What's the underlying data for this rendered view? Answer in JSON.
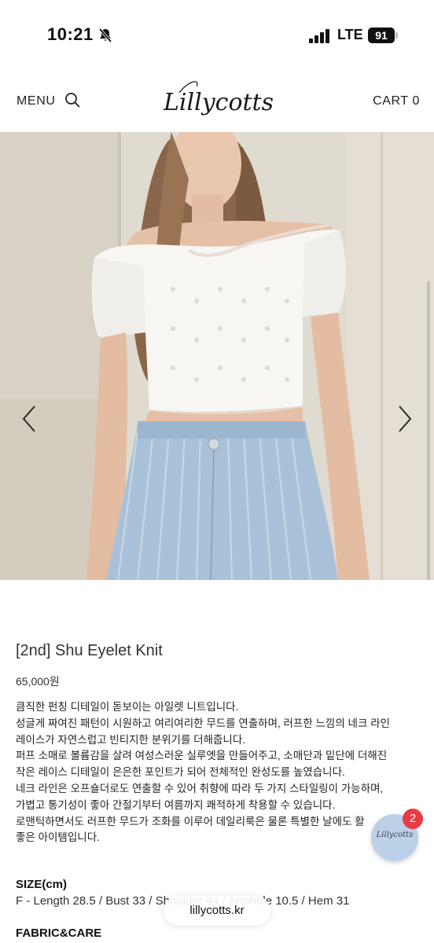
{
  "status_bar": {
    "time": "10:21",
    "network": "LTE",
    "battery": "91"
  },
  "header": {
    "menu_label": "MENU",
    "logo_text": "Lillycotts",
    "cart_label": "CART 0"
  },
  "product": {
    "title": "[2nd] Shu Eyelet Knit",
    "price": "65,000원",
    "description": [
      "큼직한 펀칭 디테일이 돋보이는 아일렛 니트입니다.",
      "성글게 짜여진 패턴이 시원하고 여리여리한 무드를 연출하며, 러프한 느낌의 네크 라인",
      "레이스가 자연스럽고 빈티지한 분위기를 더해줍니다.",
      "퍼프 소매로 볼륨감을 살려 여성스러운 실루엣을 만들어주고, 소매단과 밑단에 더해진",
      "작은 레이스 디테일이 은은한 포인트가 되어 전체적인 완성도를 높였습니다.",
      "네크 라인은 오프숄더로도 연출할 수 있어 취향에 따라 두 가지 스타일링이 가능하며,",
      "가볍고 통기성이 좋아 간절기부터 여름까지 쾌적하게 착용할 수 있습니다.",
      "로맨틱하면서도 러프한 무드가 조화를 이루어 데일리룩은 물론 특별한 날에도 활",
      "좋은 아이템입니다."
    ],
    "size_heading": "SIZE(cm)",
    "size_detail": "F - Length 28.5 / Bust 33 / Shoulder 44 / Armhole 10.5 / Hem 31",
    "fabric_heading": "FABRIC&CARE"
  },
  "floating_chat": {
    "logo_text": "Lillycotts",
    "badge_count": "2"
  },
  "browser": {
    "url": "lillycotts.kr"
  },
  "icons": {
    "bell": "bell-slash-icon",
    "search": "search-icon",
    "prev": "chevron-left-icon",
    "next": "chevron-right-icon"
  },
  "colors": {
    "badge_red": "#ea3b42",
    "float_button": "#bcd0e8"
  }
}
